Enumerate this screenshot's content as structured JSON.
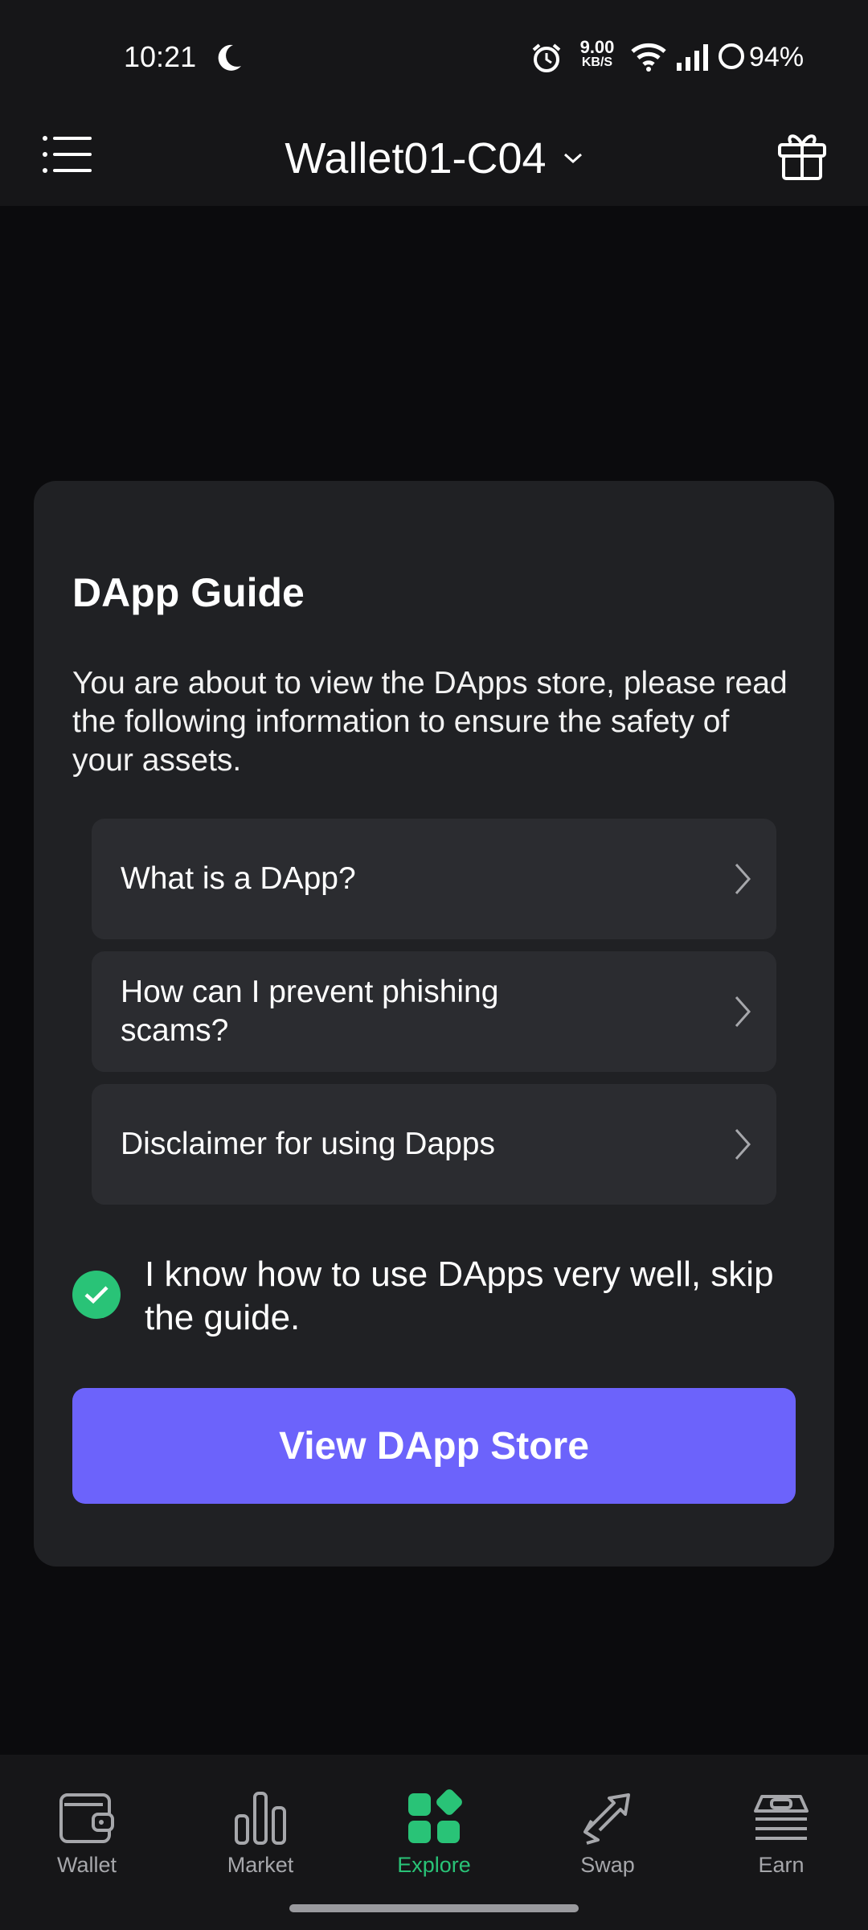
{
  "status_bar": {
    "time": "10:21",
    "net_speed_value": "9.00",
    "net_speed_unit": "KB/S",
    "battery": "94%"
  },
  "header": {
    "wallet_name": "Wallet01-C04"
  },
  "dialog": {
    "title": "DApp Guide",
    "description": "You are about to view the DApps store, please read the following information to ensure the safety of your assets.",
    "items": [
      {
        "label": "What is a DApp?"
      },
      {
        "label": "How can I prevent phishing scams?"
      },
      {
        "label": "Disclaimer for using Dapps"
      }
    ],
    "skip_label": "I know how to use DApps very well, skip the guide.",
    "skip_checked": true,
    "primary_button": "View DApp Store"
  },
  "bottom_nav": {
    "items": [
      {
        "label": "Wallet",
        "icon": "wallet-icon"
      },
      {
        "label": "Market",
        "icon": "market-icon"
      },
      {
        "label": "Explore",
        "icon": "explore-icon",
        "active": true
      },
      {
        "label": "Swap",
        "icon": "swap-icon"
      },
      {
        "label": "Earn",
        "icon": "earn-icon"
      }
    ]
  },
  "colors": {
    "accent": "#6c63fb",
    "active": "#29c377",
    "card": "#202124",
    "item": "#2b2c30"
  }
}
